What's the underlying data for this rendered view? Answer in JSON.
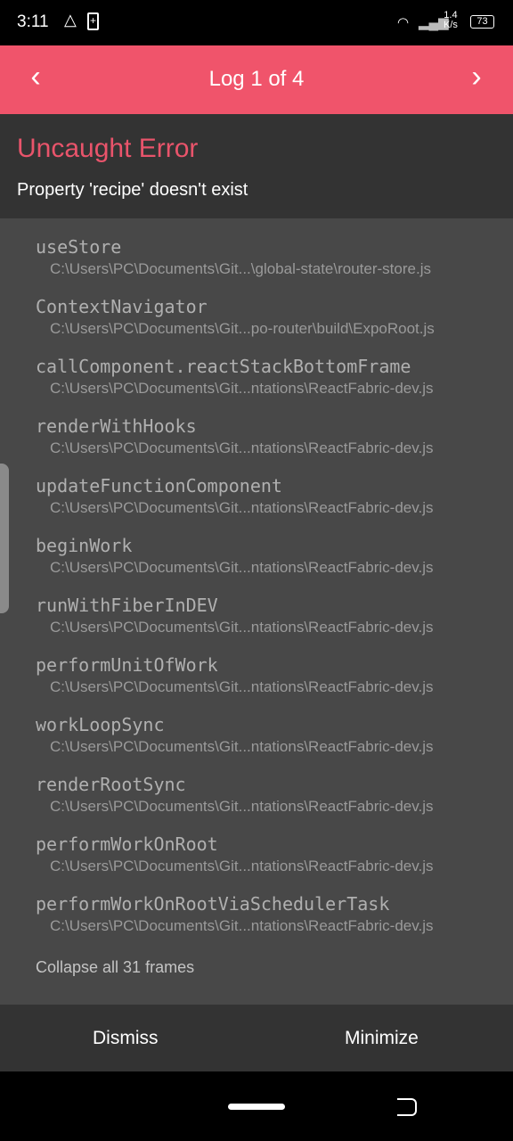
{
  "status_bar": {
    "time": "3:11",
    "speed_value": "1.4",
    "speed_unit": "K/s",
    "battery": "73"
  },
  "header": {
    "title": "Log 1 of 4",
    "prev_icon": "chevron-left",
    "next_icon": "chevron-right"
  },
  "error": {
    "type": "Uncaught Error",
    "message": "Property 'recipe' doesn't exist"
  },
  "frames": [
    {
      "name": "useStore",
      "path": "C:\\Users\\PC\\Documents\\Git...\\global-state\\router-store.js"
    },
    {
      "name": "ContextNavigator",
      "path": "C:\\Users\\PC\\Documents\\Git...po-router\\build\\ExpoRoot.js"
    },
    {
      "name": "callComponent.reactStackBottomFrame",
      "path": "C:\\Users\\PC\\Documents\\Git...ntations\\ReactFabric-dev.js"
    },
    {
      "name": "renderWithHooks",
      "path": "C:\\Users\\PC\\Documents\\Git...ntations\\ReactFabric-dev.js"
    },
    {
      "name": "updateFunctionComponent",
      "path": "C:\\Users\\PC\\Documents\\Git...ntations\\ReactFabric-dev.js"
    },
    {
      "name": "beginWork",
      "path": "C:\\Users\\PC\\Documents\\Git...ntations\\ReactFabric-dev.js"
    },
    {
      "name": "runWithFiberInDEV",
      "path": "C:\\Users\\PC\\Documents\\Git...ntations\\ReactFabric-dev.js"
    },
    {
      "name": "performUnitOfWork",
      "path": "C:\\Users\\PC\\Documents\\Git...ntations\\ReactFabric-dev.js"
    },
    {
      "name": "workLoopSync",
      "path": "C:\\Users\\PC\\Documents\\Git...ntations\\ReactFabric-dev.js"
    },
    {
      "name": "renderRootSync",
      "path": "C:\\Users\\PC\\Documents\\Git...ntations\\ReactFabric-dev.js"
    },
    {
      "name": "performWorkOnRoot",
      "path": "C:\\Users\\PC\\Documents\\Git...ntations\\ReactFabric-dev.js"
    },
    {
      "name": "performWorkOnRootViaSchedulerTask",
      "path": "C:\\Users\\PC\\Documents\\Git...ntations\\ReactFabric-dev.js"
    }
  ],
  "collapse_label": "Collapse all 31 frames",
  "buttons": {
    "dismiss": "Dismiss",
    "minimize": "Minimize"
  },
  "colors": {
    "accent": "#f0546b",
    "panel": "#333333",
    "list_bg": "#484848"
  }
}
